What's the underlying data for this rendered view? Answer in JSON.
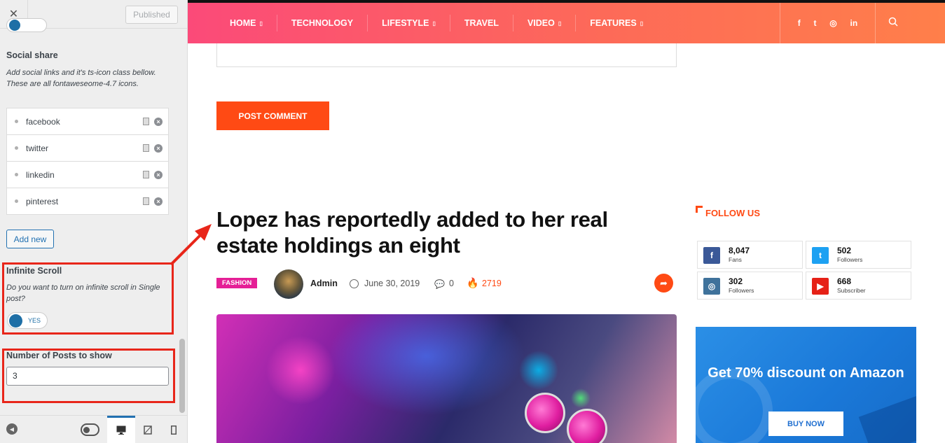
{
  "customizer": {
    "close_icon": "close-icon",
    "publish_label": "Published",
    "social_share": {
      "title": "Social share",
      "description": "Add social links and it's ts-icon class bellow. These are all fontaweseome-4.7 icons.",
      "items": [
        {
          "label": "facebook"
        },
        {
          "label": "twitter"
        },
        {
          "label": "linkedin"
        },
        {
          "label": "pinterest"
        }
      ],
      "add_new_label": "Add new"
    },
    "infinite_scroll": {
      "title": "Infinite Scroll",
      "description": "Do you want to turn on infinite scroll in Single post?",
      "toggle_label": "YES",
      "toggle_on": true
    },
    "posts_to_show": {
      "title": "Number of Posts to show",
      "value": "3"
    },
    "footer_icons": [
      "collapse-icon",
      "preview-toggle-icon",
      "desktop-icon",
      "tablet-icon",
      "mobile-icon"
    ],
    "accent_color": "#2271b1",
    "highlight_color": "#e8261a"
  },
  "site": {
    "nav": [
      {
        "label": "HOME",
        "has_dropdown": true
      },
      {
        "label": "TECHNOLOGY",
        "has_dropdown": false
      },
      {
        "label": "LIFESTYLE",
        "has_dropdown": true
      },
      {
        "label": "TRAVEL",
        "has_dropdown": false
      },
      {
        "label": "VIDEO",
        "has_dropdown": true
      },
      {
        "label": "FEATURES",
        "has_dropdown": true
      }
    ],
    "social_icons": [
      {
        "icon": "facebook-icon",
        "glyph": "f"
      },
      {
        "icon": "twitter-icon",
        "glyph": "t"
      },
      {
        "icon": "instagram-icon",
        "glyph": "◎"
      },
      {
        "icon": "linkedin-icon",
        "glyph": "in"
      }
    ],
    "search_icon": "search-icon",
    "header_gradient": [
      "#fb4a79",
      "#ff7f4a"
    ],
    "brand_color": "#ff4a14"
  },
  "main": {
    "post_comment_label": "POST COMMENT",
    "article": {
      "title": "Lopez has reportedly added to her real estate holdings an eight",
      "category": "FASHION",
      "author": "Admin",
      "date": "June 30, 2019",
      "comments": "0",
      "views": "2719"
    }
  },
  "widgets": {
    "follow_title": "FOLLOW US",
    "counters": [
      {
        "network": "facebook",
        "count": "8,047",
        "label": "Fans",
        "color": "#3b5998",
        "glyph": "f"
      },
      {
        "network": "twitter",
        "count": "502",
        "label": "Followers",
        "color": "#1da1f2",
        "glyph": "t"
      },
      {
        "network": "instagram",
        "count": "302",
        "label": "Followers",
        "color": "#3f729b",
        "glyph": "◎"
      },
      {
        "network": "youtube",
        "count": "668",
        "label": "Subscriber",
        "color": "#e62117",
        "glyph": "▶"
      }
    ],
    "ad": {
      "headline": "Get 70% discount on Amazon",
      "button": "BUY NOW"
    }
  }
}
